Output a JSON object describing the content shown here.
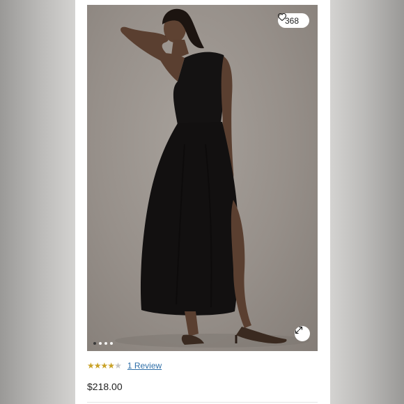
{
  "product": {
    "likes_count": "368",
    "rating": {
      "value": 4,
      "max": 5
    },
    "review_link": "1 Review",
    "price": "$218.00"
  },
  "gallery": {
    "image_count": 4,
    "active_index": 0
  },
  "icons": {
    "likes": "heart-icon",
    "expand": "expand-icon",
    "star": "star-icon"
  },
  "colors": {
    "star_filled": "#c9a227",
    "star_empty": "#c4c4c4",
    "link": "#2f6fa8"
  }
}
